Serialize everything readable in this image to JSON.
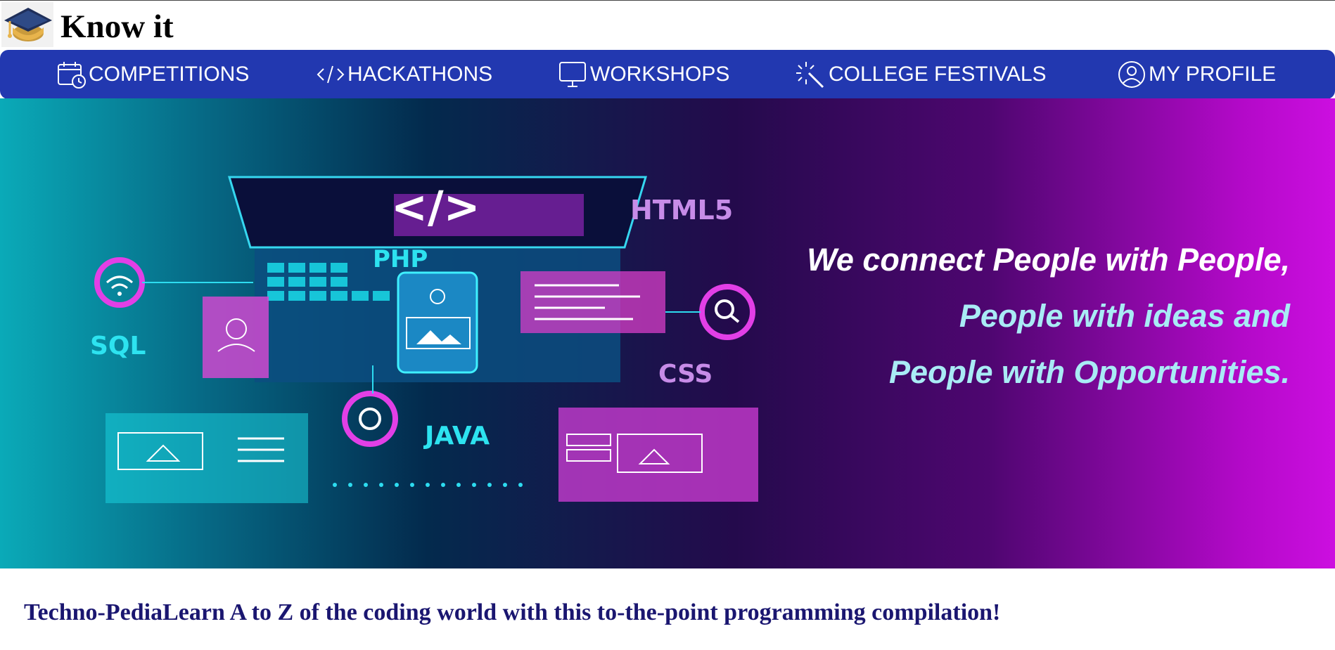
{
  "header": {
    "title": "Know it",
    "logo_icon": "graduation-cap-icon"
  },
  "nav": {
    "items": [
      {
        "label": "COMPETITIONS",
        "icon": "calendar-clock-icon"
      },
      {
        "label": "HACKATHONS",
        "icon": "code-icon"
      },
      {
        "label": "WORKSHOPS",
        "icon": "monitor-icon"
      },
      {
        "label": "COLLEGE FESTIVALS",
        "icon": "magic-wand-icon"
      },
      {
        "label": "MY PROFILE",
        "icon": "user-circle-icon"
      }
    ],
    "background": "#2238b0"
  },
  "hero": {
    "tagline": [
      "We connect People with People,",
      "People with ideas and",
      "People with Opportunities."
    ],
    "illustration_labels": {
      "code_symbol": "</>",
      "html": "HTML5",
      "php": "PHP",
      "sql": "SQL",
      "css": "CSS",
      "java": "JAVA"
    }
  },
  "content": {
    "caption": "Techno-PediaLearn A to Z of the coding world with this to-the-point programming compilation!"
  }
}
